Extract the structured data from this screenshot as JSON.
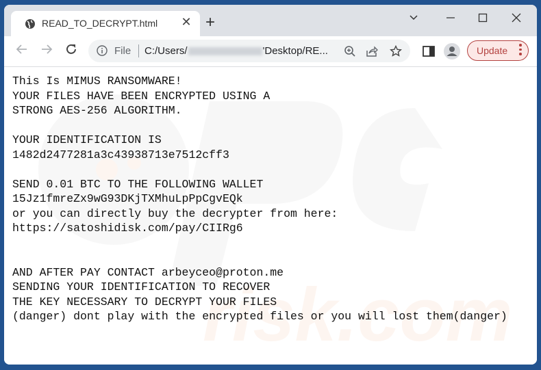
{
  "browser": {
    "tab": {
      "title": "READ_TO_DECRYPT.html",
      "icon": "globe-icon",
      "close_icon": "close-icon"
    },
    "new_tab_label": "+",
    "window_controls": [
      "chevron-down-icon",
      "minimize-icon",
      "maximize-icon",
      "close-icon"
    ],
    "omnibox": {
      "scheme_label": "File",
      "url_prefix": "C:/Users/",
      "url_suffix": "'Desktop/RE..."
    },
    "update_button_label": "Update"
  },
  "note": {
    "lines": [
      "This Is MIMUS RANSOMWARE!",
      "YOUR FILES HAVE BEEN ENCRYPTED USING A",
      "STRONG AES-256 ALGORITHM.",
      "",
      "YOUR IDENTIFICATION IS",
      "1482d2477281a3c43938713e7512cff3",
      "",
      "SEND 0.01 BTC TO THE FOLLOWING WALLET",
      "15Jz1fmreZx9wG93DKjTXMhuLpPpCgvEQk",
      "or you can directly buy the decrypter from here:",
      "https://satoshidisk.com/pay/CIIRg6",
      "",
      "",
      "AND AFTER PAY CONTACT arbeyceo@proton.me",
      "SENDING YOUR IDENTIFICATION TO RECOVER",
      "THE KEY NECESSARY TO DECRYPT YOUR FILES",
      "(danger) dont play with the encrypted files or you will lost them(danger)"
    ]
  }
}
